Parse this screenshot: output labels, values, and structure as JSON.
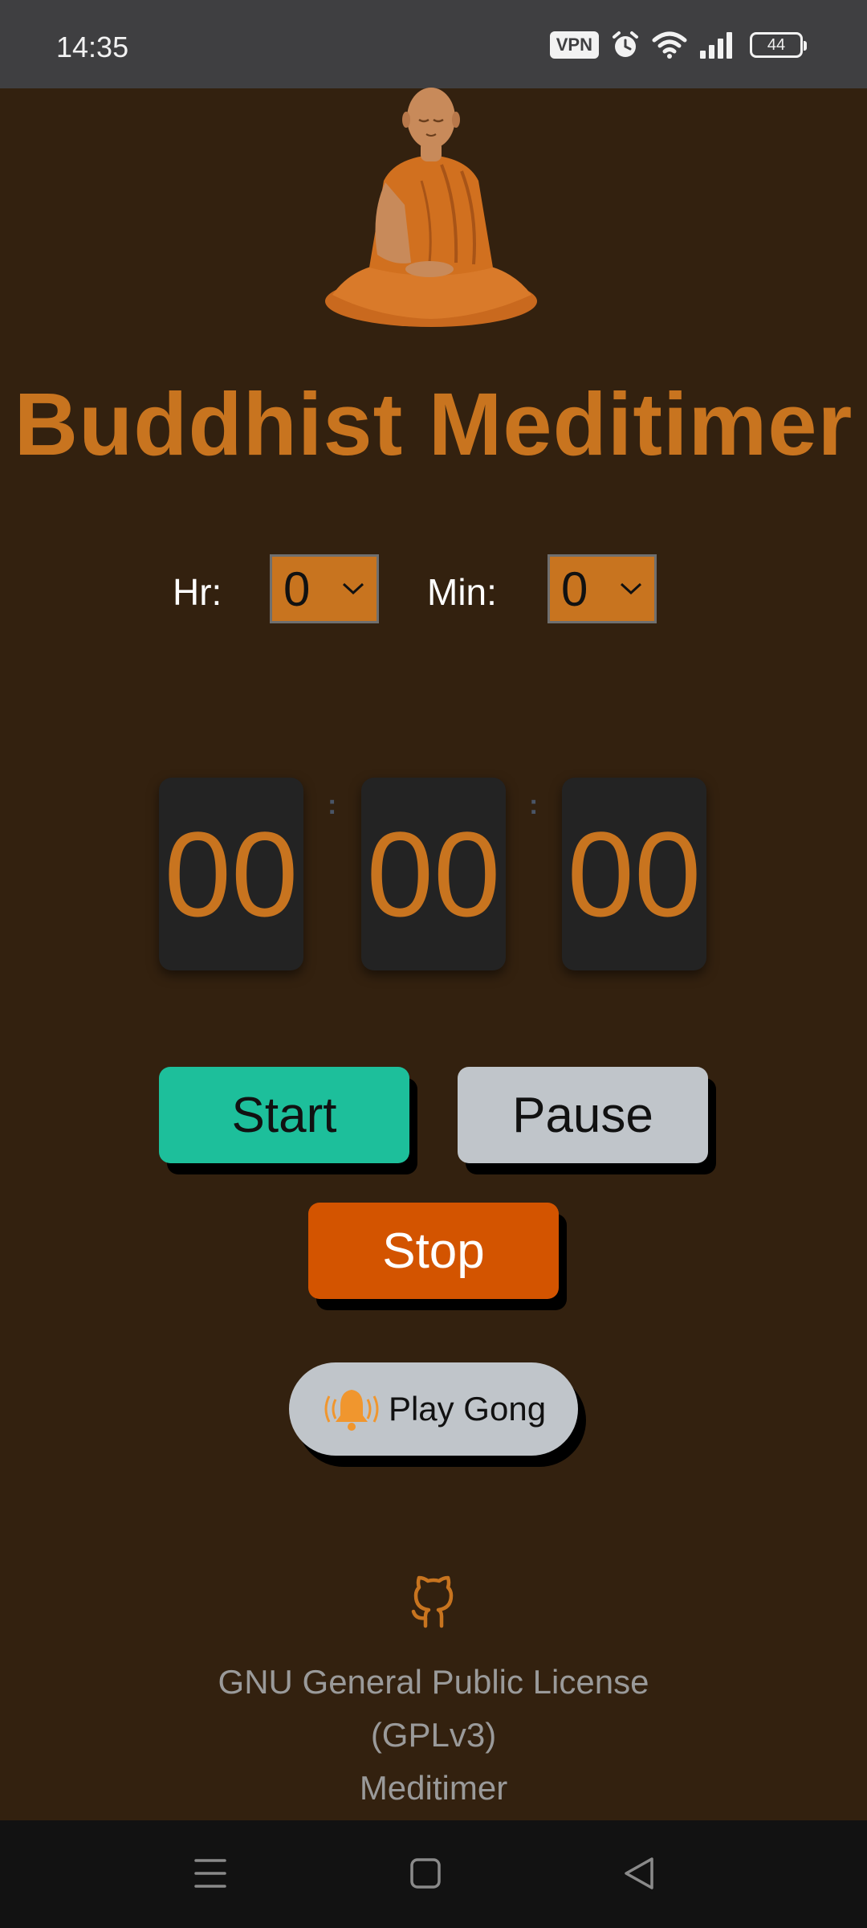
{
  "status_bar": {
    "time": "14:35",
    "vpn_label": "VPN",
    "battery_level": "44",
    "icons": [
      "vpn-icon",
      "alarm-icon",
      "wifi-icon",
      "signal-icon",
      "battery-icon"
    ]
  },
  "header": {
    "logo": "meditating-monk",
    "title": "Buddhist Meditimer"
  },
  "duration": {
    "hours_label": "Hr:",
    "hours_value": "0",
    "minutes_label": "Min:",
    "minutes_value": "0"
  },
  "countdown": {
    "hours": "00",
    "separator": ":",
    "minutes": "00",
    "seconds": "00"
  },
  "controls": {
    "start_label": "Start",
    "pause_label": "Pause",
    "stop_label": "Stop",
    "gong_label": "Play Gong",
    "gong_icon": "bell-icon"
  },
  "footer": {
    "github_icon": "github-icon",
    "license_line1": "GNU General Public License",
    "license_line2": "(GPLv3)",
    "license_line3": "Meditimer"
  },
  "nav_bar": {
    "buttons": [
      "menu-icon",
      "home-icon",
      "back-icon"
    ]
  },
  "colors": {
    "background": "#33210f",
    "accent": "#c8741f",
    "start": "#1dbf9b",
    "pause": "#c0c5ca",
    "stop": "#d35400",
    "card": "#232323"
  }
}
